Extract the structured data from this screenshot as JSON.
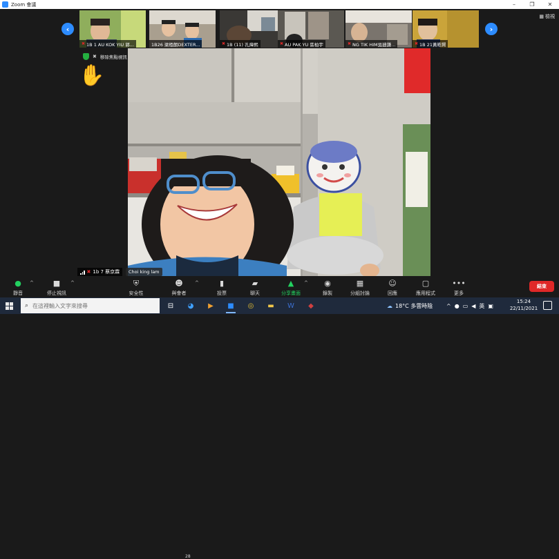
{
  "window": {
    "title": "Zoom 會議",
    "controls": [
      "–",
      "❐",
      "✕"
    ]
  },
  "strip": {
    "prev_label": "‹",
    "next_label": "›",
    "view_label": "檢視",
    "participants": [
      {
        "name": "1B 1 AU KOK YIU 郭...",
        "bg": "#6f8b4a"
      },
      {
        "name": "1B26 梁栢朗DEXTER...",
        "bg": "#8a8172"
      },
      {
        "name": "1B (11) 孔煒熙",
        "bg": "#5d5a54"
      },
      {
        "name": "AU PAK YU 區柏宇",
        "bg": "#4a4a47"
      },
      {
        "name": "NG TIK HIM吳廸謙...",
        "bg": "#6c6863"
      },
      {
        "name": "1B 21黃皓賢",
        "bg": "#c9a53a"
      }
    ]
  },
  "overlay": {
    "pin_label": "移除焦點視訊",
    "hand_icon": "✋"
  },
  "main": {
    "name": "1b 7 蔡京霖",
    "hover_name": "Choi king lam"
  },
  "toolbar": {
    "mute": "靜音",
    "stop_video": "停止視訊",
    "security": "安全性",
    "participants": "與會者",
    "participants_count": "28",
    "polls": "投票",
    "chat": "聊天",
    "share": "分享畫面",
    "record": "錄製",
    "breakout": "分組討論",
    "reactions": "回應",
    "apps": "應用程式",
    "more": "更多",
    "end": "結束"
  },
  "taskbar": {
    "search_placeholder": "在這裡輸入文字來搜尋",
    "weather": "18°C 多雲時陰",
    "ime": "英",
    "time": "15:24",
    "date": "22/11/2021"
  },
  "colors": {
    "accent": "#2d8cff",
    "end": "#e02828",
    "share": "#23d160"
  }
}
